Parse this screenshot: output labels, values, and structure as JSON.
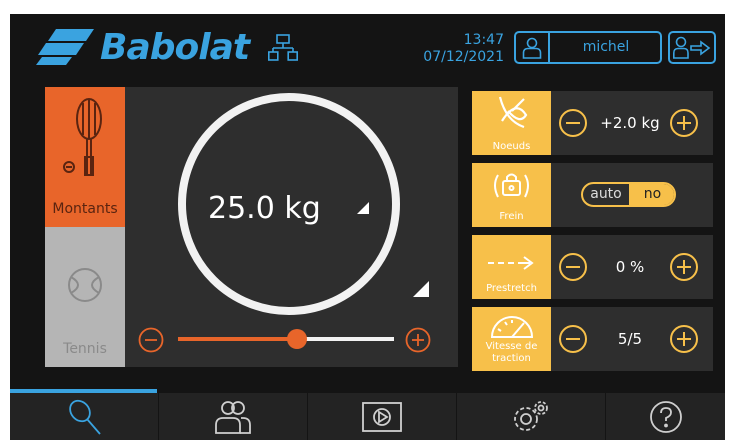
{
  "header": {
    "brand": "Babolat",
    "time": "13:47",
    "date": "07/12/2021",
    "user": "michel"
  },
  "modes": {
    "tabs": [
      {
        "label": "Montants",
        "active": true
      },
      {
        "label": "Tennis",
        "active": false
      }
    ]
  },
  "tension": {
    "value_label": "25.0 kg",
    "slider_level": 0.55
  },
  "settings": {
    "knots": {
      "label": "Noeuds",
      "value": "+2.0 kg"
    },
    "brake": {
      "label": "Frein",
      "option_auto": "auto",
      "option_no": "no"
    },
    "prestretch": {
      "label": "Prestretch",
      "value": "0 %"
    },
    "speed": {
      "label_line1": "Vitesse de",
      "label_line2": "traction",
      "value": "5/5"
    }
  },
  "nav": {
    "active_index": 0,
    "items": [
      "racket-icon",
      "users-icon",
      "play-icon",
      "settings-gears-icon",
      "help-icon"
    ]
  },
  "colors": {
    "accent_blue": "#3aa3e0",
    "accent_orange": "#e8652a",
    "accent_yellow": "#f7c04a",
    "background": "#141414",
    "panel": "#2e2e2e"
  }
}
